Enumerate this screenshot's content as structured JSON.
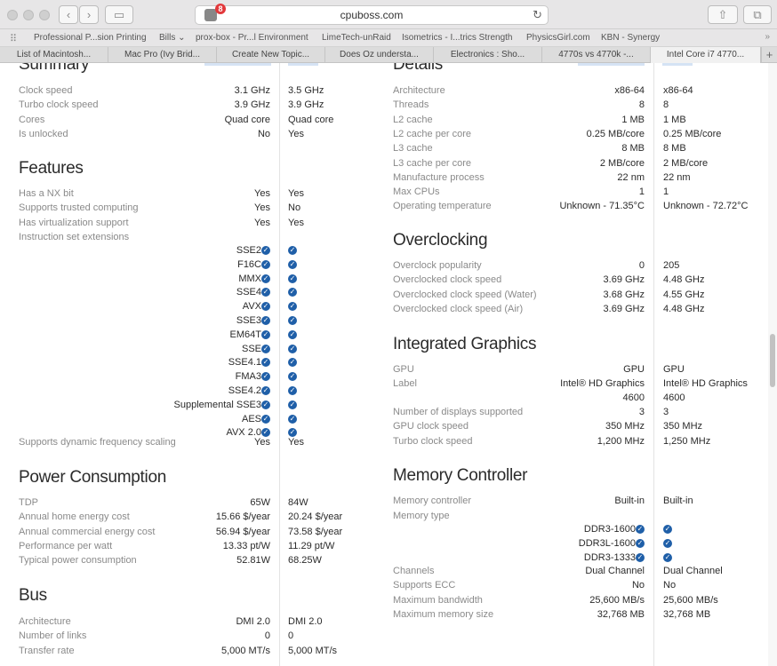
{
  "browser": {
    "url": "cpuboss.com",
    "shield_count": "8",
    "favorites": [
      "Professional P...sion Printing",
      "Bills ⌄",
      "prox-box - Pr...l Environment",
      "LimeTech-unRaid",
      "Isometrics - I...trics Strength",
      "PhysicsGirl.com",
      "KBN - Synergy"
    ],
    "tabs": [
      "List of Macintosh...",
      "Mac Pro (Ivy Brid...",
      "Create New Topic...",
      "Does Oz understa...",
      "Electronics : Sho...",
      "4770s vs 4770k -...",
      "Intel Core i7 4770..."
    ]
  },
  "left": {
    "summary": {
      "title": "Summary",
      "rows": [
        {
          "label": "Clock speed",
          "a": "3.1 GHz",
          "b": "3.5 GHz"
        },
        {
          "label": "Turbo clock speed",
          "a": "3.9 GHz",
          "b": "3.9 GHz"
        },
        {
          "label": "Cores",
          "a": "Quad core",
          "b": "Quad core"
        },
        {
          "label": "Is unlocked",
          "a": "No",
          "b": "Yes"
        }
      ]
    },
    "features": {
      "title": "Features",
      "rows": [
        {
          "label": "Has a NX bit",
          "a": "Yes",
          "b": "Yes"
        },
        {
          "label": "Supports trusted computing",
          "a": "Yes",
          "b": "No"
        },
        {
          "label": "Has virtualization support",
          "a": "Yes",
          "b": "Yes"
        }
      ],
      "ext_label": "Instruction set extensions",
      "extensions": [
        "SSE2",
        "F16C",
        "MMX",
        "SSE4",
        "AVX",
        "SSE3",
        "EM64T",
        "SSE",
        "SSE4.1",
        "FMA3",
        "SSE4.2",
        "Supplemental SSE3",
        "AES",
        "AVX 2.0"
      ],
      "dyn": {
        "label": "Supports dynamic frequency scaling",
        "a": "Yes",
        "b": "Yes"
      }
    },
    "power": {
      "title": "Power Consumption",
      "rows": [
        {
          "label": "TDP",
          "a": "65W",
          "b": "84W"
        },
        {
          "label": "Annual home energy cost",
          "a": "15.66 $/year",
          "b": "20.24 $/year"
        },
        {
          "label": "Annual commercial energy cost",
          "a": "56.94 $/year",
          "b": "73.58 $/year"
        },
        {
          "label": "Performance per watt",
          "a": "13.33 pt/W",
          "b": "11.29 pt/W"
        },
        {
          "label": "Typical power consumption",
          "a": "52.81W",
          "b": "68.25W"
        }
      ]
    },
    "bus": {
      "title": "Bus",
      "rows": [
        {
          "label": "Architecture",
          "a": "DMI 2.0",
          "b": "DMI 2.0"
        },
        {
          "label": "Number of links",
          "a": "0",
          "b": "0"
        },
        {
          "label": "Transfer rate",
          "a": "5,000 MT/s",
          "b": "5,000 MT/s"
        }
      ]
    }
  },
  "right": {
    "details": {
      "title": "Details",
      "rows": [
        {
          "label": "Architecture",
          "a": "x86-64",
          "b": "x86-64"
        },
        {
          "label": "Threads",
          "a": "8",
          "b": "8"
        },
        {
          "label": "L2 cache",
          "a": "1 MB",
          "b": "1 MB"
        },
        {
          "label": "L2 cache per core",
          "a": "0.25 MB/core",
          "b": "0.25 MB/core"
        },
        {
          "label": "L3 cache",
          "a": "8 MB",
          "b": "8 MB"
        },
        {
          "label": "L3 cache per core",
          "a": "2 MB/core",
          "b": "2 MB/core"
        },
        {
          "label": "Manufacture process",
          "a": "22 nm",
          "b": "22 nm"
        },
        {
          "label": "Max CPUs",
          "a": "1",
          "b": "1"
        },
        {
          "label": "Operating temperature",
          "a": "Unknown - 71.35°C",
          "b": "Unknown - 72.72°C"
        }
      ]
    },
    "overclocking": {
      "title": "Overclocking",
      "rows": [
        {
          "label": "Overclock popularity",
          "a": "0",
          "b": "205"
        },
        {
          "label": "Overclocked clock speed",
          "a": "3.69 GHz",
          "b": "4.48 GHz"
        },
        {
          "label": "Overclocked clock speed (Water)",
          "a": "3.68 GHz",
          "b": "4.55 GHz"
        },
        {
          "label": "Overclocked clock speed (Air)",
          "a": "3.69 GHz",
          "b": "4.48 GHz"
        }
      ]
    },
    "graphics": {
      "title": "Integrated Graphics",
      "gpu": {
        "label": "GPU",
        "a": "GPU",
        "b": "GPU"
      },
      "label_row": {
        "label": "Label",
        "a1": "Intel® HD Graphics",
        "a2": "4600",
        "b1": "Intel® HD Graphics",
        "b2": "4600"
      },
      "rows": [
        {
          "label": "Number of displays supported",
          "a": "3",
          "b": "3"
        },
        {
          "label": "GPU clock speed",
          "a": "350 MHz",
          "b": "350 MHz"
        },
        {
          "label": "Turbo clock speed",
          "a": "1,200 MHz",
          "b": "1,250 MHz"
        }
      ]
    },
    "memory": {
      "title": "Memory Controller",
      "controller": {
        "label": "Memory controller",
        "a": "Built-in",
        "b": "Built-in"
      },
      "type_label": "Memory type",
      "types": [
        "DDR3-1600",
        "DDR3L-1600",
        "DDR3-1333"
      ],
      "rows": [
        {
          "label": "Channels",
          "a": "Dual Channel",
          "b": "Dual Channel"
        },
        {
          "label": "Supports ECC",
          "a": "No",
          "b": "No"
        },
        {
          "label": "Maximum bandwidth",
          "a": "25,600 MB/s",
          "b": "25,600 MB/s"
        },
        {
          "label": "Maximum memory size",
          "a": "32,768 MB",
          "b": "32,768 MB"
        }
      ]
    }
  },
  "colors": {
    "accent": "#1f5fa8",
    "label": "#8a8a8a"
  }
}
